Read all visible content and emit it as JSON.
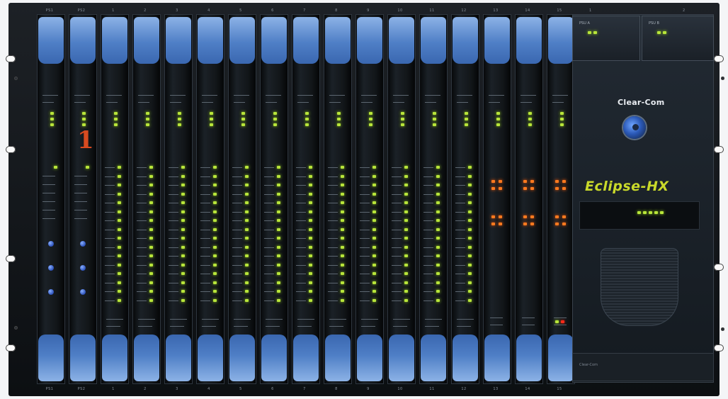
{
  "slots": {
    "top_labels": [
      "PS1",
      "PS2",
      "1",
      "2",
      "3",
      "4",
      "5",
      "6",
      "7",
      "8",
      "9",
      "10",
      "11",
      "12",
      "13",
      "14",
      "15"
    ],
    "bottom_labels": [
      "PS1",
      "PS2",
      "1",
      "2",
      "3",
      "4",
      "5",
      "6",
      "7",
      "8",
      "9",
      "10",
      "11",
      "12",
      "13",
      "14",
      "15"
    ]
  },
  "right_top_labels": [
    "1",
    "2"
  ],
  "power_supplies": [
    {
      "label": "PSU A"
    },
    {
      "label": "PSU B"
    }
  ],
  "front_panel": {
    "brand": "Clear-Com",
    "model": "Eclipse-HX",
    "slot_marker": "1",
    "footer": "Clear-Com"
  },
  "colors": {
    "chassis": "#111518",
    "ejector": "#5a87cb",
    "led_green": "#b8e53a",
    "led_orange": "#ff7a1f",
    "accent_model": "#c9d92a",
    "slot_marker": "#d84a20"
  }
}
